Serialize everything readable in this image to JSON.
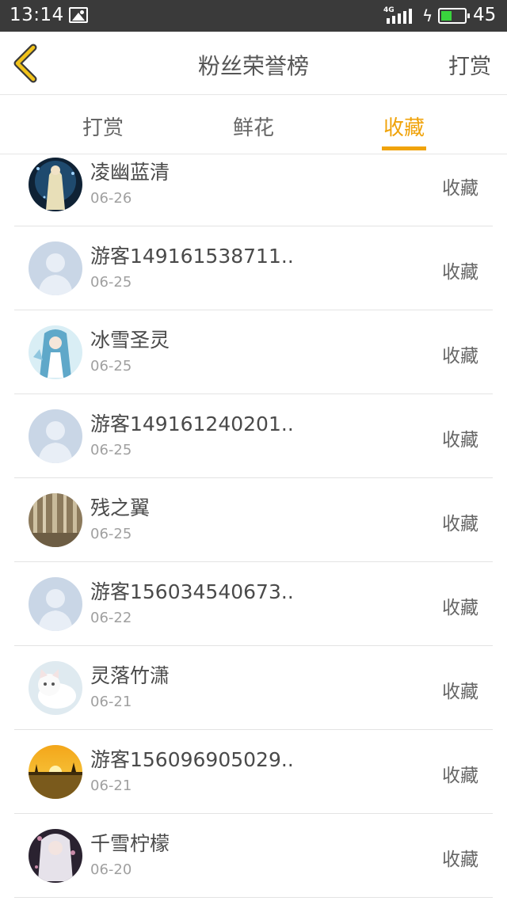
{
  "status_bar": {
    "time": "13:14",
    "network": "4G",
    "battery_level": "45",
    "battery_fraction": 0.45
  },
  "header": {
    "title": "粉丝荣誉榜",
    "action_label": "打赏"
  },
  "tabs": [
    {
      "label": "打赏",
      "active": false
    },
    {
      "label": "鲜花",
      "active": false
    },
    {
      "label": "收藏",
      "active": true
    }
  ],
  "accent_color": "#f0a30a",
  "list": [
    {
      "name": "凌幽蓝清",
      "date": "06-26",
      "type": "收藏",
      "avatar": "anime-girl-dark-blue"
    },
    {
      "name": "游客149161538711..",
      "date": "06-25",
      "type": "收藏",
      "avatar": "default-user"
    },
    {
      "name": "冰雪圣灵",
      "date": "06-25",
      "type": "收藏",
      "avatar": "anime-ice-girl"
    },
    {
      "name": "游客149161240201..",
      "date": "06-25",
      "type": "收藏",
      "avatar": "default-user"
    },
    {
      "name": "残之翼",
      "date": "06-25",
      "type": "收藏",
      "avatar": "birch-forest"
    },
    {
      "name": "游客156034540673..",
      "date": "06-22",
      "type": "收藏",
      "avatar": "default-user"
    },
    {
      "name": "灵落竹潇",
      "date": "06-21",
      "type": "收藏",
      "avatar": "white-cat"
    },
    {
      "name": "游客156096905029..",
      "date": "06-21",
      "type": "收藏",
      "avatar": "sunset-field"
    },
    {
      "name": "千雪柠檬",
      "date": "06-20",
      "type": "收藏",
      "avatar": "anime-girl-white-hair"
    }
  ]
}
